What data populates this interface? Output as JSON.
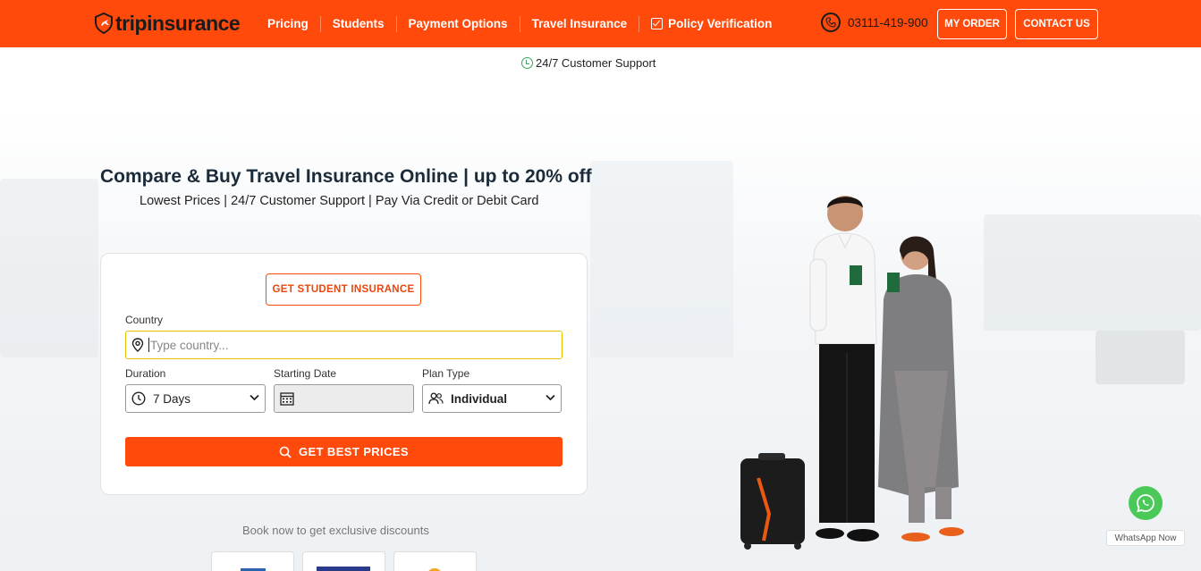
{
  "nav": {
    "logo_part1": "trip",
    "logo_part2": "insurance",
    "menu": [
      "Pricing",
      "Students",
      "Payment Options",
      "Travel Insurance",
      "Policy Verification"
    ],
    "phone": "03111-419-900",
    "my_order": "MY ORDER",
    "contact_us": "CONTACT US"
  },
  "support": "24/7 Customer Support",
  "hero": {
    "title": "Compare & Buy Travel Insurance Online | up to 20% off",
    "subtitle": "Lowest Prices | 24/7 Customer Support | Pay Via Credit or Debit Card"
  },
  "form": {
    "student_button": "GET STUDENT INSURANCE",
    "country_label": "Country",
    "country_placeholder": "Type country...",
    "duration_label": "Duration",
    "duration_value": "7 Days",
    "start_label": "Starting Date",
    "start_value": "",
    "plan_label": "Plan Type",
    "plan_value": "Individual",
    "submit": "GET BEST PRICES"
  },
  "book_text": "Book now to get exclusive discounts",
  "whatsapp": "WhatsApp Now",
  "colors": {
    "brand": "#ff4a0b",
    "whatsapp": "#4ac959"
  }
}
